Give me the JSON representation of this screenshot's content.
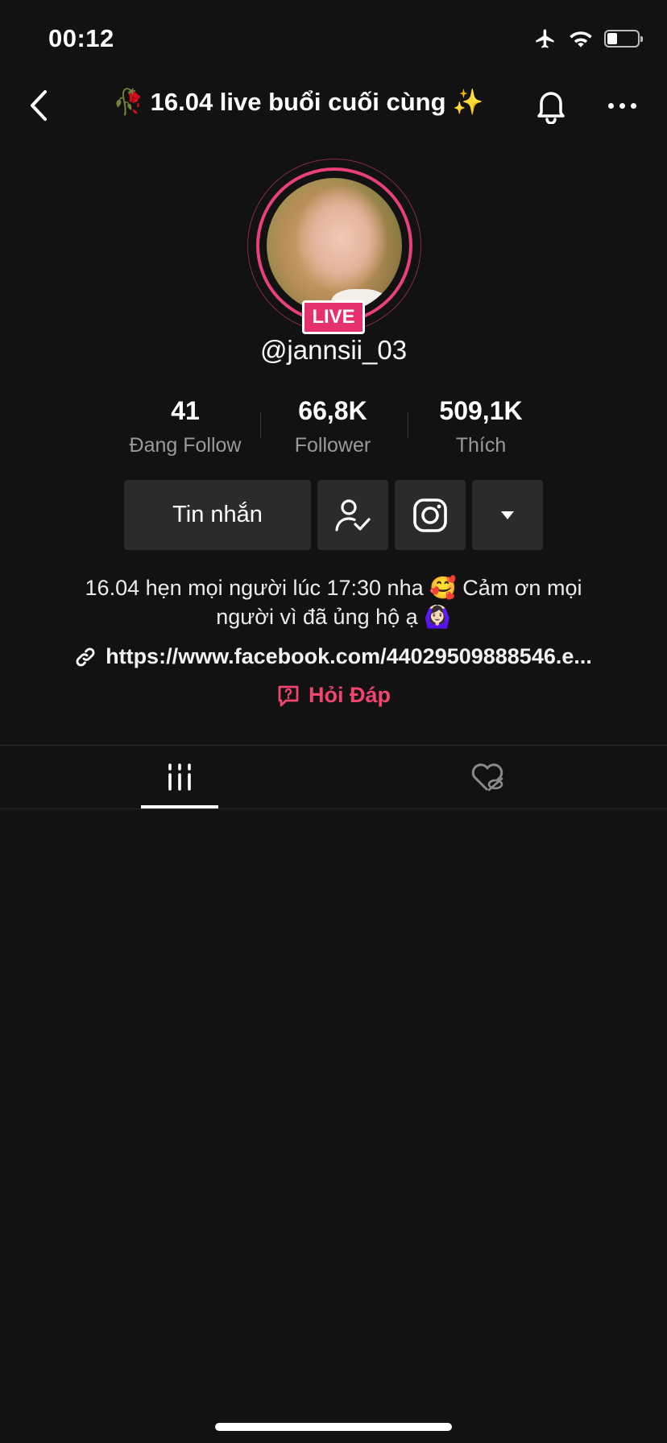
{
  "status_bar": {
    "time": "00:12"
  },
  "header": {
    "title_emoji_left": "🥀",
    "title": "16.04 live buổi cuối cùng",
    "title_emoji_right": "✨"
  },
  "profile": {
    "live_badge": "LIVE",
    "username": "@jannsii_03"
  },
  "stats": [
    {
      "value": "41",
      "label": "Đang Follow"
    },
    {
      "value": "66,8K",
      "label": "Follower"
    },
    {
      "value": "509,1K",
      "label": "Thích"
    }
  ],
  "actions": {
    "message_label": "Tin nhắn"
  },
  "bio": {
    "line1": "16.04 hẹn mọi người lúc 17:30 nha 🥰 Cảm ơn mọi",
    "line2": "người vì đã ủng hộ ạ 🙆🏻‍♀️"
  },
  "link": {
    "text": "https://www.facebook.com/44029509888546.e..."
  },
  "qa": {
    "label": "Hỏi Đáp"
  },
  "colors": {
    "accent": "#e8407a",
    "qa": "#f0456e",
    "background": "#121212",
    "button": "#2b2b2b"
  },
  "tabs": [
    {
      "icon": "grid-icon",
      "active": true
    },
    {
      "icon": "hidden-likes-icon",
      "active": false
    }
  ]
}
